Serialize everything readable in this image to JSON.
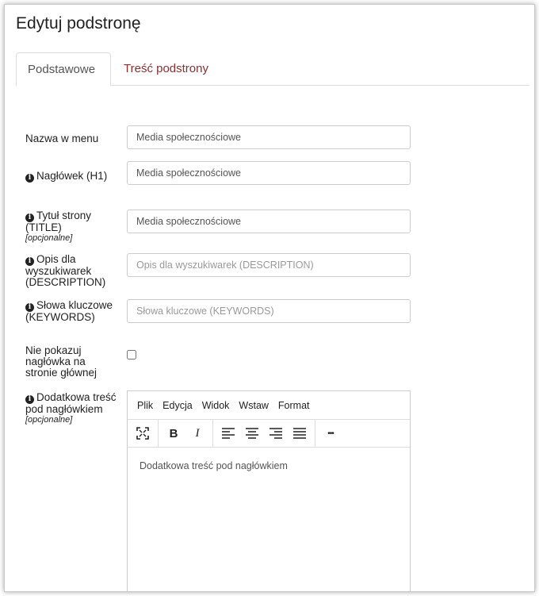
{
  "page": {
    "title": "Edytuj podstronę"
  },
  "tabs": [
    {
      "label": "Podstawowe",
      "active": true
    },
    {
      "label": "Treść podstrony",
      "active": false
    }
  ],
  "form": {
    "menu_name": {
      "label": "Nazwa w menu",
      "value": "Media społecznościowe"
    },
    "heading": {
      "label": "Nagłówek (H1)",
      "value": "Media społecznościowe"
    },
    "page_title": {
      "label": "Tytuł strony (TITLE)",
      "optional": "[opcjonalne]",
      "value": "Media społecznościowe"
    },
    "description": {
      "label": "Opis dla wyszukiwarek (DESCRIPTION)",
      "placeholder": "Opis dla wyszukiwarek (DESCRIPTION)"
    },
    "keywords": {
      "label": "Słowa kluczowe (KEYWORDS)",
      "placeholder": "Słowa kluczowe (KEYWORDS)"
    },
    "hide_heading": {
      "label": "Nie pokazuj nagłówka na stronie głównej",
      "checked": false
    },
    "extra_content": {
      "label": "Dodatkowa treść pod nagłówkiem",
      "optional": "[opcjonalne]",
      "placeholder": "Dodatkowa treść pod nagłówkiem"
    }
  },
  "editor": {
    "menu": [
      "Plik",
      "Edycja",
      "Widok",
      "Wstaw",
      "Format"
    ],
    "toolbar": {
      "fullscreen": "fullscreen-icon",
      "bold": "B",
      "italic": "I",
      "align_left": "align-left-icon",
      "align_center": "align-center-icon",
      "align_right": "align-right-icon",
      "align_justify": "align-justify-icon",
      "more": "•••"
    }
  },
  "colors": {
    "tab_inactive": "#8b2f2f",
    "border": "#cccccc"
  }
}
